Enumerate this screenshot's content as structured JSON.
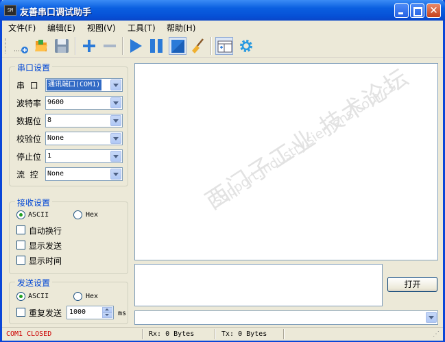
{
  "window": {
    "title": "友善串口调试助手",
    "app_icon_text": "SM"
  },
  "menu": [
    {
      "label": "文件(F)"
    },
    {
      "label": "编辑(E)"
    },
    {
      "label": "视图(V)"
    },
    {
      "label": "工具(T)"
    },
    {
      "label": "帮助(H)"
    }
  ],
  "toolbar": {
    "icons": [
      "new-icon",
      "open-icon",
      "save-icon",
      "add-icon",
      "remove-icon",
      "play-icon",
      "pause-icon",
      "stop-icon",
      "clear-brush-icon",
      "layout-icon",
      "settings-gear-icon"
    ],
    "colors": {
      "blue": "#2a7ad8",
      "green": "#3aa845",
      "orange": "#f09a20"
    }
  },
  "serial_settings": {
    "title": "串口设置",
    "rows": [
      {
        "label": "串  口",
        "value": "通讯端口(COM1)"
      },
      {
        "label": "波特率",
        "value": "9600"
      },
      {
        "label": "数据位",
        "value": "8"
      },
      {
        "label": "校验位",
        "value": "None"
      },
      {
        "label": "停止位",
        "value": "1"
      },
      {
        "label": "流  控",
        "value": "None"
      }
    ]
  },
  "receive_settings": {
    "title": "接收设置",
    "ascii_label": "ASCII",
    "hex_label": "Hex",
    "mode": "ASCII",
    "auto_wrap_label": "自动换行",
    "show_send_label": "显示发送",
    "show_time_label": "显示时间"
  },
  "send_settings": {
    "title": "发送设置",
    "ascii_label": "ASCII",
    "hex_label": "Hex",
    "mode": "ASCII",
    "repeat_label": "重复发送",
    "interval_value": "1000",
    "interval_unit": "ms"
  },
  "actions": {
    "open_label": "打开"
  },
  "status": {
    "port_state": "COM1 CLOSED",
    "port_state_color": "#cc0000",
    "rx": "Rx: 0 Bytes",
    "tx": "Tx: 0 Bytes"
  },
  "watermark": {
    "line1": "西门子工业  技术论坛",
    "line2": "support.industry.siemens.com/cs"
  }
}
